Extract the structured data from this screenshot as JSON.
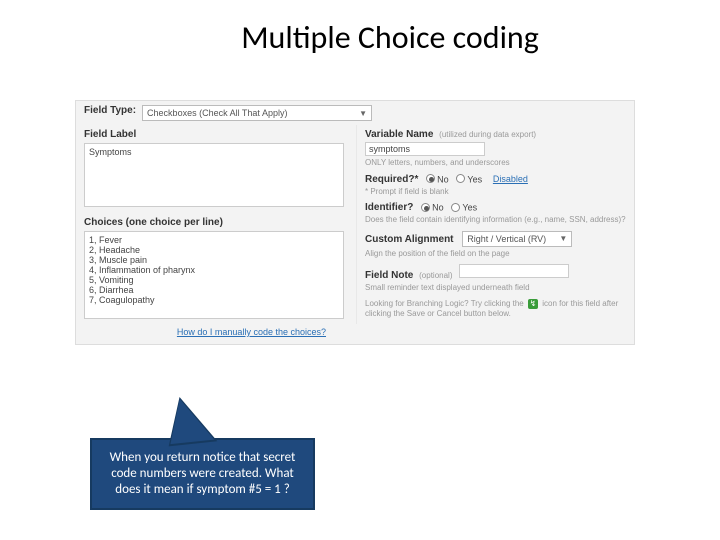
{
  "title": "Multiple Choice coding",
  "form": {
    "fieldTypeLabel": "Field Type:",
    "fieldTypeValue": "Checkboxes (Check All That Apply)",
    "fieldLabelHead": "Field Label",
    "fieldLabelValue": "Symptoms",
    "choicesHead": "Choices (one choice per line)",
    "choicesText": "1, Fever\n2, Headache\n3, Muscle pain\n4, Inflammation of pharynx\n5, Vomiting\n6, Diarrhea\n7, Coagulopathy",
    "howCodeLink": "How do I manually code the choices?",
    "varNameLabel": "Variable Name",
    "varNameHint": "(utilized during data export)",
    "varNameValue": "symptoms",
    "varNameNote": "ONLY letters, numbers, and underscores",
    "requiredLabel": "Required?*",
    "no": "No",
    "yes": "Yes",
    "disabledLink": "Disabled",
    "requiredNote": "* Prompt if field is blank",
    "identifierLabel": "Identifier?",
    "identifierNote": "Does the field contain identifying information (e.g., name, SSN, address)?",
    "alignLabel": "Custom Alignment",
    "alignValue": "Right / Vertical (RV)",
    "alignNote": "Align the position of the field on the page",
    "noteLabel": "Field Note",
    "noteOptional": "(optional)",
    "noteHint": "Small reminder text displayed underneath field",
    "branchText1": "Looking for Branching Logic? Try clicking the ",
    "branchText2": " icon for this field after clicking the Save or Cancel button below."
  },
  "callout": "When you return notice that secret code numbers were created.  What does it mean if symptom #5 = 1 ?"
}
